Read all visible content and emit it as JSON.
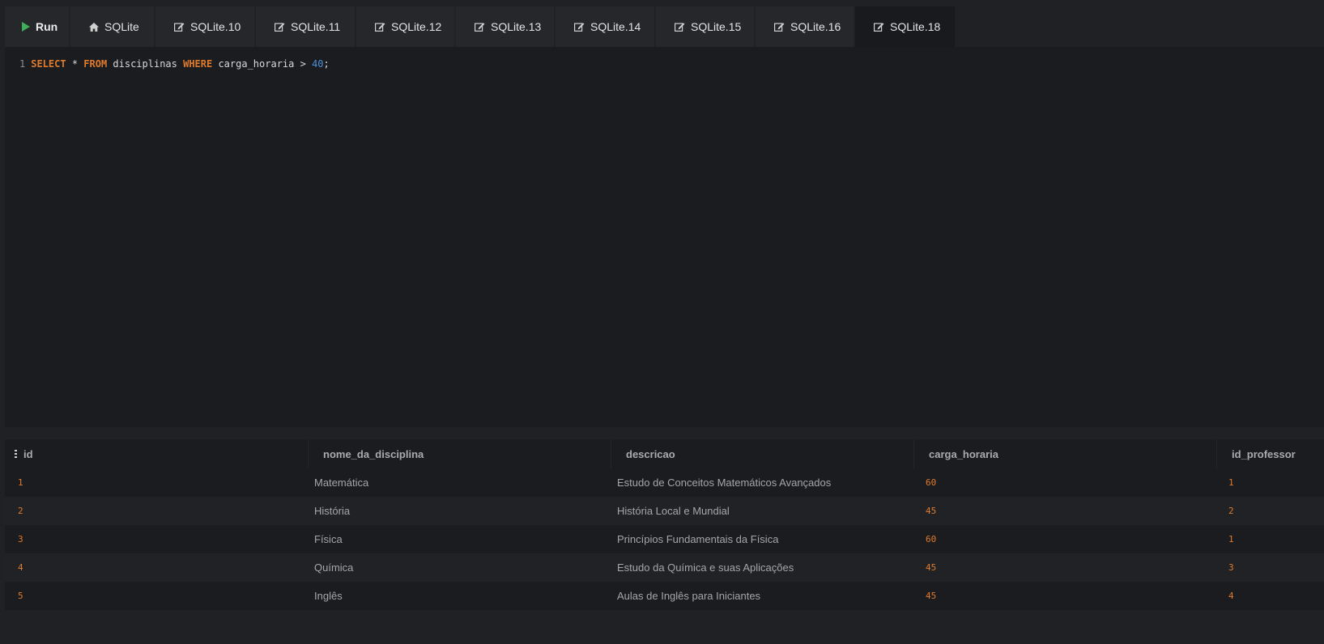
{
  "toolbar": {
    "run_label": "Run",
    "tabs": [
      {
        "label": "SQLite",
        "icon": "home-icon"
      },
      {
        "label": "SQLite.10",
        "icon": "edit-icon"
      },
      {
        "label": "SQLite.11",
        "icon": "edit-icon"
      },
      {
        "label": "SQLite.12",
        "icon": "edit-icon"
      },
      {
        "label": "SQLite.13",
        "icon": "edit-icon"
      },
      {
        "label": "SQLite.14",
        "icon": "edit-icon"
      },
      {
        "label": "SQLite.15",
        "icon": "edit-icon"
      },
      {
        "label": "SQLite.16",
        "icon": "edit-icon"
      },
      {
        "label": "SQLite.18",
        "icon": "edit-icon",
        "active": true
      }
    ]
  },
  "editor": {
    "line_number": "1",
    "query": {
      "select": "SELECT",
      "star": " * ",
      "from": "FROM",
      "table": " disciplinas ",
      "where": "WHERE",
      "condition": " carga_horaria > ",
      "value": "40",
      "end": ";"
    }
  },
  "results": {
    "columns": [
      "id",
      "nome_da_disciplina",
      "descricao",
      "carga_horaria",
      "id_professor"
    ],
    "rows": [
      {
        "id": "1",
        "nome_da_disciplina": "Matemática",
        "descricao": "Estudo de Conceitos Matemáticos Avançados",
        "carga_horaria": "60",
        "id_professor": "1"
      },
      {
        "id": "2",
        "nome_da_disciplina": "História",
        "descricao": "História Local e Mundial",
        "carga_horaria": "45",
        "id_professor": "2"
      },
      {
        "id": "3",
        "nome_da_disciplina": "Física",
        "descricao": "Princípios Fundamentais da Física",
        "carga_horaria": "60",
        "id_professor": "1"
      },
      {
        "id": "4",
        "nome_da_disciplina": "Química",
        "descricao": "Estudo da Química e suas Aplicações",
        "carga_horaria": "45",
        "id_professor": "3"
      },
      {
        "id": "5",
        "nome_da_disciplina": "Inglês",
        "descricao": "Aulas de Inglês para Iniciantes",
        "carga_horaria": "45",
        "id_professor": "4"
      }
    ]
  },
  "colors": {
    "accent_orange": "#e07b2b",
    "run_green": "#3fae5a",
    "number_blue": "#4f8fd8",
    "background": "#1f2125"
  }
}
